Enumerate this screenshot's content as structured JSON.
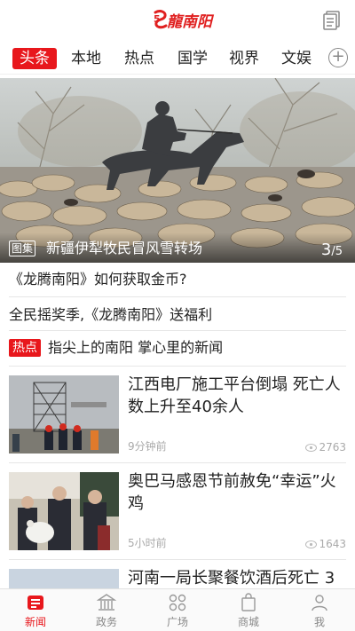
{
  "header": {
    "logo_text": "龍南阳",
    "logo_mark": "5",
    "logo_icon": "logo-mark-icon",
    "right_icon": "document-icon"
  },
  "tabs": [
    {
      "label": "头条",
      "active": true
    },
    {
      "label": "本地",
      "active": false
    },
    {
      "label": "热点",
      "active": false
    },
    {
      "label": "国学",
      "active": false
    },
    {
      "label": "视界",
      "active": false
    },
    {
      "label": "文娱",
      "active": false
    }
  ],
  "tabs_add_symbol": "+",
  "hero": {
    "badge": "图集",
    "title": "新疆伊犁牧民冒风雪转场",
    "current": "3",
    "total": "/5"
  },
  "text_rows": [
    "《龙腾南阳》如何获取金币?",
    "全民摇奖季,《龙腾南阳》送福利"
  ],
  "hot": {
    "tag": "热点",
    "text": "指尖上的南阳 掌心里的新闻"
  },
  "news": [
    {
      "title": "江西电厂施工平台倒塌 死亡人数上升至40余人",
      "time": "9分钟前",
      "views": "2763"
    },
    {
      "title": "奥巴马感恩节前赦免“幸运”火鸡",
      "time": "5小时前",
      "views": "1643"
    },
    {
      "title": "河南一局长聚餐饮酒后死亡 3",
      "time": "",
      "views": ""
    }
  ],
  "tabbar": [
    {
      "label": "新闻",
      "icon": "news-icon",
      "active": true
    },
    {
      "label": "政务",
      "icon": "government-building-icon",
      "active": false
    },
    {
      "label": "广场",
      "icon": "square-grid-icon",
      "active": false
    },
    {
      "label": "商城",
      "icon": "shopping-bag-icon",
      "active": false
    },
    {
      "label": "我",
      "icon": "person-icon",
      "active": false
    }
  ],
  "colors": {
    "accent": "#e8171c",
    "muted": "#aaaaaa"
  }
}
